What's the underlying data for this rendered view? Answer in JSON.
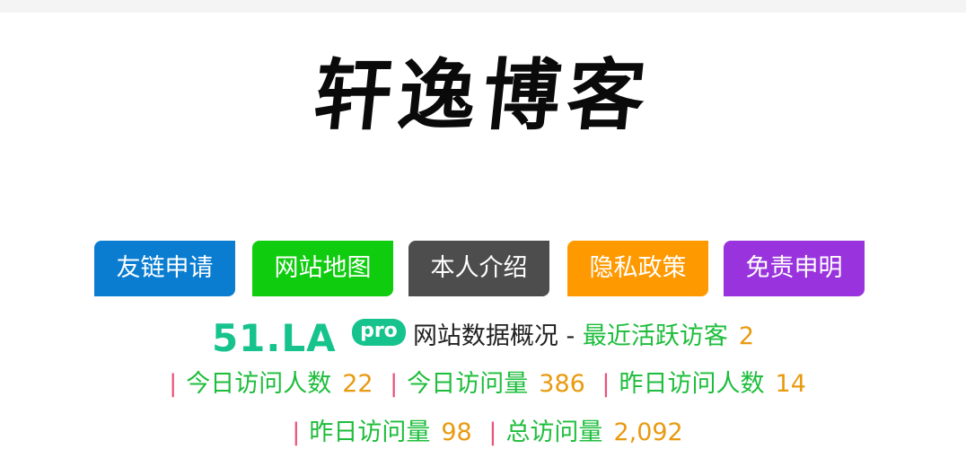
{
  "site": {
    "title": "轩逸博客"
  },
  "nav": {
    "items": [
      {
        "label": "友链申请",
        "color": "#0a7dd1"
      },
      {
        "label": "网站地图",
        "color": "#0fcc0f"
      },
      {
        "label": "本人介绍",
        "color": "#4d4d4d"
      },
      {
        "label": "隐私政策",
        "color": "#ff9900"
      },
      {
        "label": "免责申明",
        "color": "#9933dd"
      }
    ]
  },
  "stats": {
    "logo_text": "51.LA",
    "logo_badge": "pro",
    "overview_label": "网站数据概况",
    "dash": "-",
    "active_visitors_label": "最近活跃访客",
    "active_visitors_value": "2",
    "separator": "|",
    "today_visitors_label": "今日访问人数",
    "today_visitors_value": "22",
    "today_views_label": "今日访问量",
    "today_views_value": "386",
    "yesterday_visitors_label": "昨日访问人数",
    "yesterday_visitors_value": "14",
    "yesterday_views_label": "昨日访问量",
    "yesterday_views_value": "98",
    "total_views_label": "总访问量",
    "total_views_value": "2,092"
  }
}
